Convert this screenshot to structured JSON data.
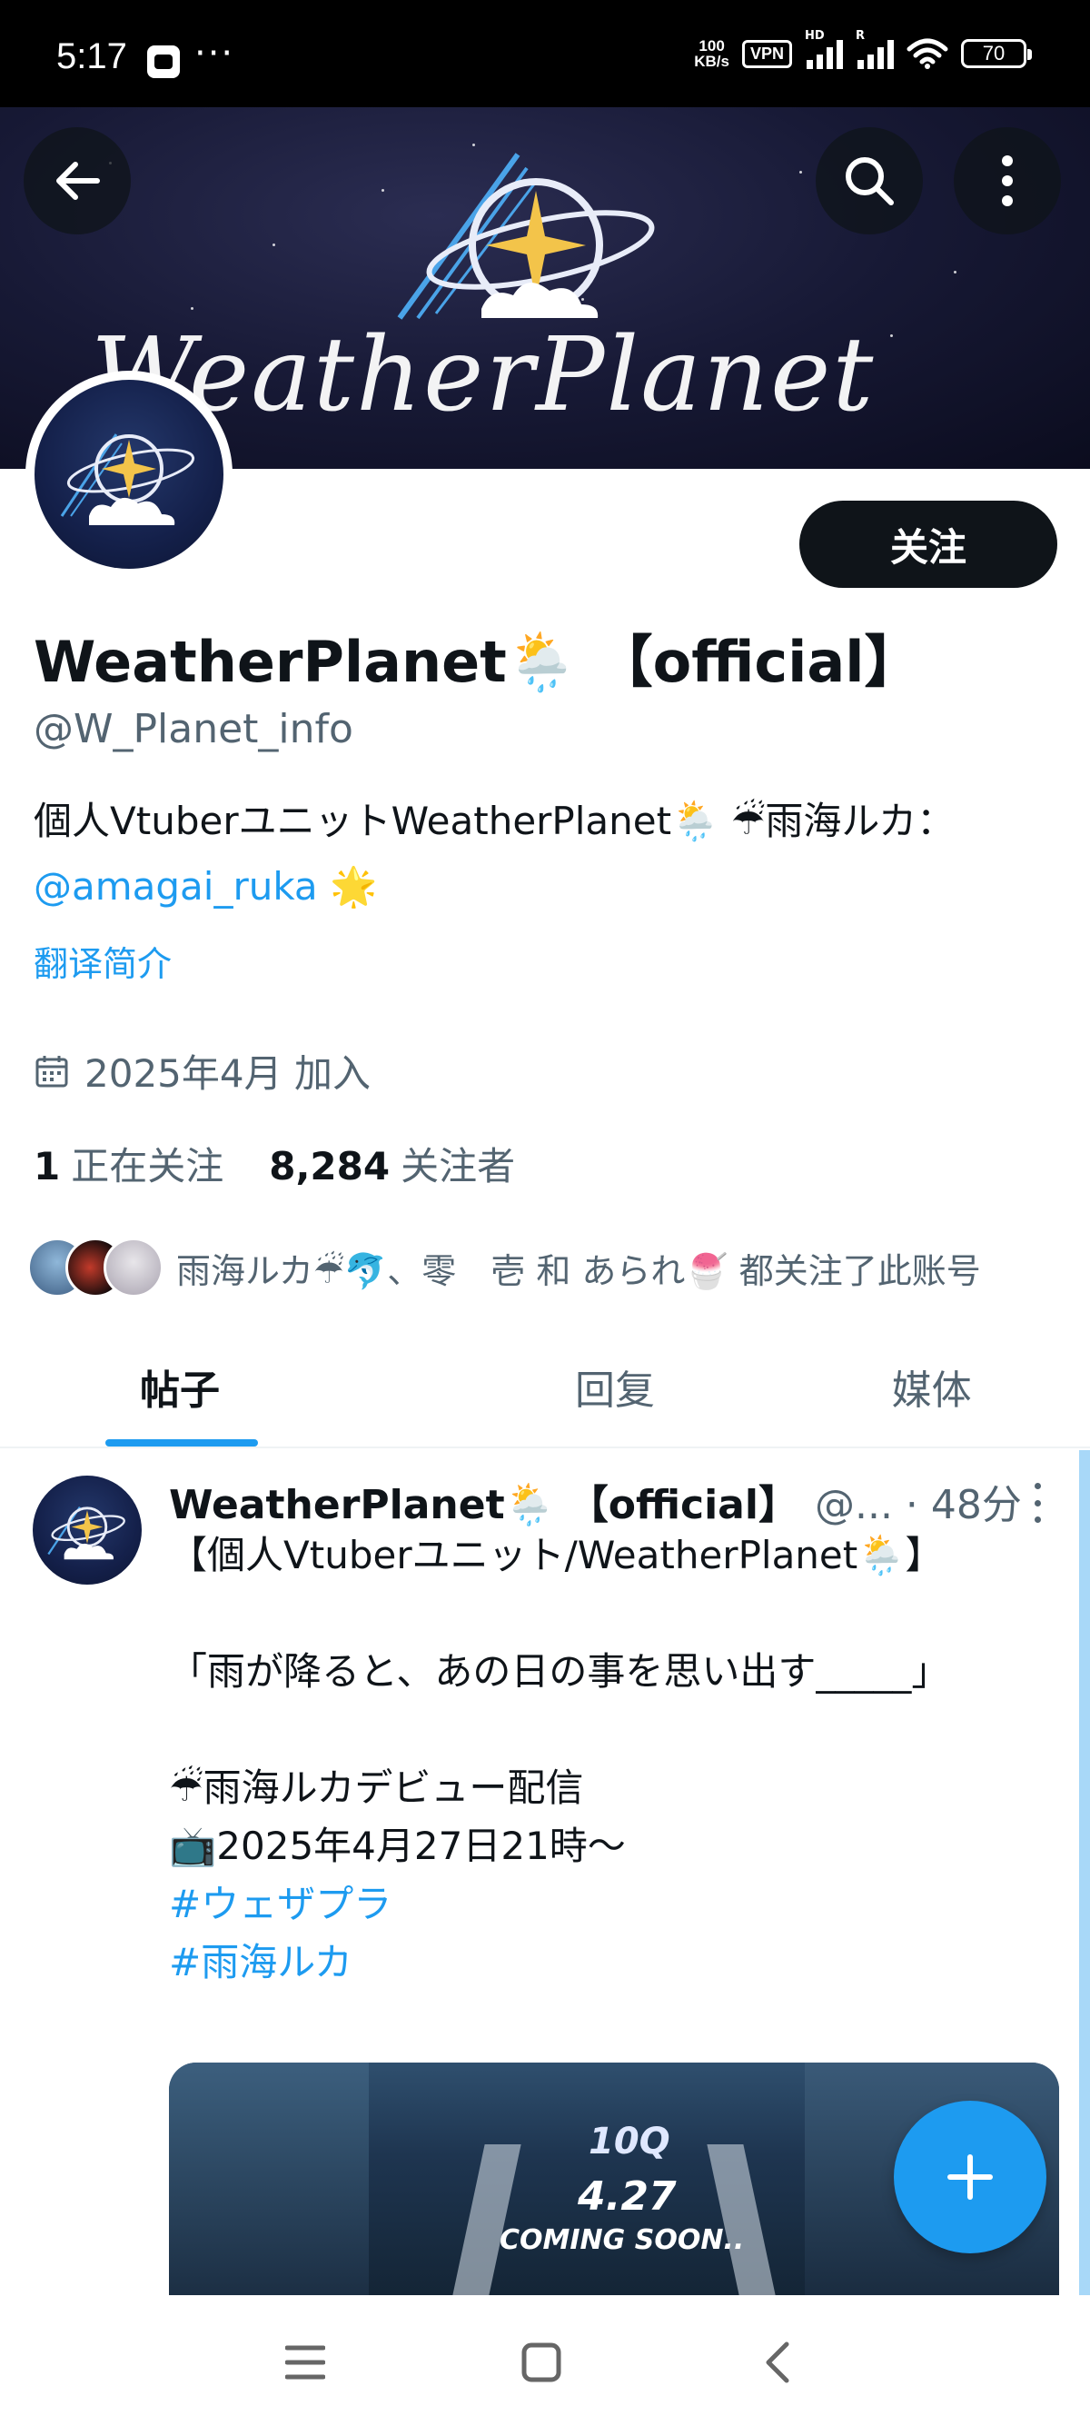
{
  "status_bar": {
    "time": "5:17",
    "more": "···",
    "speed_top": "100",
    "speed_bottom": "KB/s",
    "vpn": "VPN",
    "sim1_label": "HD",
    "sim2_label": "R",
    "battery": "70"
  },
  "banner": {
    "logo_text": "WeatherPlanet"
  },
  "profile": {
    "follow_label": "关注",
    "display_name": "WeatherPlanet🌦️ 【official】",
    "handle": "@W_Planet_info",
    "bio_text": "個人VtuberユニットWeatherPlanet🌦️ ☔雨海ルカ：",
    "bio_mention": "@amagai_ruka",
    "bio_emoji": " 🌟",
    "translate_label": "翻译简介",
    "joined": "2025年4月 加入",
    "following_count": "1",
    "following_label": "正在关注",
    "followers_count": "8,284",
    "followers_label": "关注者",
    "followed_by": "雨海ルカ☔🐬、零　壱 和 あられ🍧 都关注了此账号"
  },
  "tabs": [
    {
      "label": "帖子",
      "active": true
    },
    {
      "label": "回复",
      "active": false
    },
    {
      "label": "媒体",
      "active": false
    }
  ],
  "tweet": {
    "name": "WeatherPlanet🌦️ 【official】",
    "meta": "@... · 48分",
    "body_lines": "【個人Vtuberユニット/WeatherPlanet🌦️】\n\n「雨が降ると、あの日の事を思い出す_____」\n\n☔雨海ルカデビュー配信\n📺2025年4月27日21時～\n",
    "hashtag1": "#ウェザプラ",
    "hashtag2": "#雨海ルカ",
    "media_logo": "10Q",
    "media_date": "4.27",
    "media_coming": "COMING SOON.."
  },
  "colors": {
    "accent": "#1d9bf0",
    "text": "#0f1419",
    "secondary": "#536471"
  }
}
